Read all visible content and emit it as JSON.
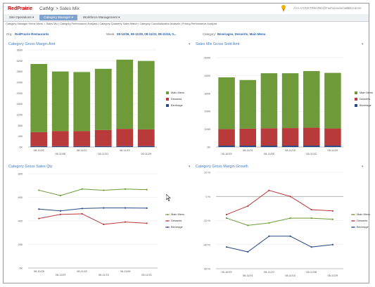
{
  "app": {
    "brand": "RedPrairie",
    "title": "CatMgr > Sales Mix",
    "user": "AYA-CONSTRBAND@Fashionsdomain",
    "brand_small": "SiteAdmin"
  },
  "nav": [
    {
      "label": "Site Operations ▾",
      "active": false
    },
    {
      "label": "Category Manager ▾",
      "active": true
    },
    {
      "label": "Workforce Management ▾",
      "active": false
    }
  ],
  "links_text": "Category Manager Home Menu > Sales Mix | Category Performance Analysis | Category Quarterly Sales Match | Category Cannibalization Analysis | Pricing Performance Analysis",
  "filters": {
    "org_label": "Org:",
    "org_value": "RedPrairie Restaurants",
    "week_label": "Week:",
    "week_value": "08-12/06, 08-11/29, 08-11/22, 08-11/15, 0...",
    "category_label": "Category:",
    "category_value": "Beverages, Desserts, Main Menu"
  },
  "colors": {
    "main_menu": "#6e9a3a",
    "desserts": "#b83a3a",
    "beverage": "#2a4a86",
    "title_blue": "#3f7bc6"
  },
  "panels": {
    "p1": {
      "title": "Category Gross Margin Amt",
      "menu": "▾"
    },
    "p2": {
      "title": "Sales Mix Gross Sold Amt",
      "menu": "▾"
    },
    "p3": {
      "title": "Category Gross Sales Qty",
      "menu": "▾"
    },
    "p4": {
      "title": "Category Gross Margin Growth",
      "menu": "▾"
    }
  },
  "chart_data": [
    {
      "type": "bar",
      "stacked": true,
      "title": "Category Gross Margin Amt",
      "categories": [
        "08-10/25",
        "08-11/08",
        "08-11/22",
        "08-11/01",
        "08-11/15",
        "08-11/29"
      ],
      "tick_rows": [
        0,
        1,
        0,
        1,
        0,
        1
      ],
      "ylim": [
        0,
        3600
      ],
      "yticks": [
        0,
        400,
        800,
        1200,
        1600,
        2000,
        2400,
        2800,
        3200,
        3600
      ],
      "ytick_labels": [
        "0K",
        "400",
        "800",
        "1200",
        "1600",
        "2000",
        "2400",
        "2800",
        "3200",
        "3600"
      ],
      "series": [
        {
          "name": "Beverage",
          "values": [
            30,
            30,
            30,
            30,
            35,
            35
          ]
        },
        {
          "name": "Desserts",
          "values": [
            520,
            560,
            560,
            600,
            640,
            620
          ]
        },
        {
          "name": "Main Menu",
          "values": [
            2530,
            2210,
            2190,
            2270,
            2565,
            2535
          ]
        }
      ],
      "legend": "right"
    },
    {
      "type": "bar",
      "stacked": true,
      "title": "Sales Mix Gross Sold Amt",
      "categories": [
        "08-10/25",
        "08-11/01",
        "08-11/08",
        "08-11/15",
        "08-11/22",
        "08-11/29"
      ],
      "tick_rows": [
        1,
        0,
        1,
        0,
        1,
        0
      ],
      "ylim": [
        0,
        5000
      ],
      "yticks": [
        0,
        1000,
        2000,
        3000,
        4000,
        5000
      ],
      "ytick_labels": [
        "0K",
        "1000",
        "2000",
        "3000",
        "4000",
        "5000"
      ],
      "series": [
        {
          "name": "Beverage",
          "values": [
            80,
            80,
            80,
            80,
            80,
            80
          ]
        },
        {
          "name": "Desserts",
          "values": [
            920,
            950,
            970,
            980,
            1000,
            960
          ]
        },
        {
          "name": "Main Menu",
          "values": [
            2900,
            2720,
            3080,
            3070,
            3170,
            3110
          ]
        }
      ],
      "legend": "right"
    },
    {
      "type": "line",
      "title": "Category Gross Sales Qty",
      "categories": [
        "08-10/25",
        "08-11/29",
        "08-11/22",
        "08-11/15",
        "08-11/08",
        "08-11/01"
      ],
      "tick_rows": [
        0,
        1,
        0,
        1,
        0,
        1
      ],
      "ylim": [
        0,
        800
      ],
      "yticks": [
        0,
        200,
        400,
        600,
        800
      ],
      "ytick_labels": [
        "0K",
        "200",
        "400",
        "600",
        "800"
      ],
      "series": [
        {
          "name": "Beverage",
          "values": [
            500,
            485,
            505,
            510,
            510,
            508
          ]
        },
        {
          "name": "Desserts",
          "values": [
            420,
            455,
            460,
            370,
            390,
            380
          ]
        },
        {
          "name": "Main Menu",
          "values": [
            660,
            615,
            670,
            660,
            670,
            665
          ]
        }
      ],
      "legend": "right"
    },
    {
      "type": "line",
      "title": "Category Gross Margin Growth",
      "categories": [
        "08-10/25",
        "08-11/01",
        "08-11/22",
        "08-11/15",
        "08-11/08",
        "08-11/29"
      ],
      "tick_rows": [
        0,
        1,
        0,
        1,
        0,
        1
      ],
      "ylim": [
        -60,
        20
      ],
      "yticks": [
        -60,
        -40,
        -20,
        0,
        20
      ],
      "ytick_labels": [
        "-60 %",
        "-40 %",
        "-20 %",
        "0 %",
        "20 %"
      ],
      "series": [
        {
          "name": "Beverage",
          "values": [
            -42,
            -46,
            -33,
            -33,
            -42,
            -40
          ]
        },
        {
          "name": "Desserts",
          "values": [
            -15,
            -8,
            5,
            0,
            -11,
            -12
          ]
        },
        {
          "name": "Main Menu",
          "values": [
            -18,
            -24,
            -22,
            -18,
            -18,
            -19
          ]
        }
      ],
      "legend": "right"
    }
  ]
}
